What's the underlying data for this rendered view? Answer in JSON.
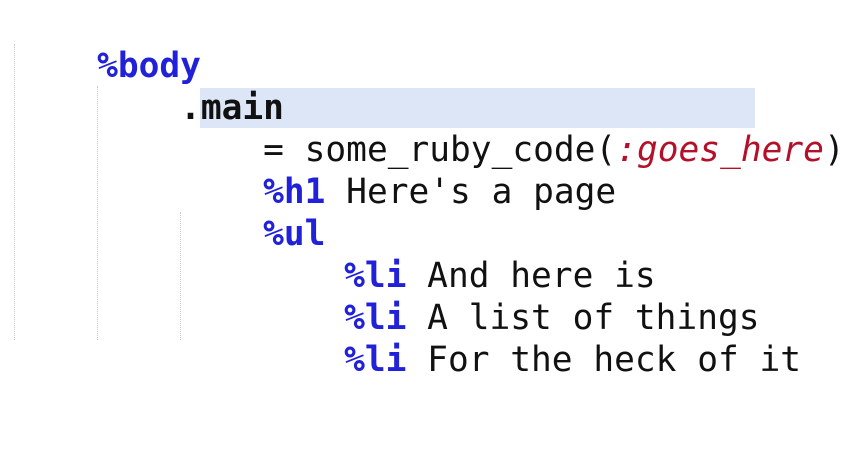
{
  "editor": {
    "lines": [
      {
        "tag": "%body"
      },
      {
        "klass": ".main"
      },
      {
        "op": "=",
        "pre": " some_ruby_code(",
        "symbol": ":goes_here",
        "post": ")"
      },
      {
        "tag": "%h1",
        "text": " Here's a page"
      },
      {
        "tag": "%ul"
      },
      {
        "tag": "%li",
        "text": " And here is"
      },
      {
        "tag": "%li",
        "text": " A list of things"
      },
      {
        "tag": "%li",
        "text": " For the heck of it"
      }
    ],
    "colors": {
      "tag": "#2121d9",
      "symbol": "#b3102a",
      "text": "#111111",
      "selection": "#dde6f7",
      "indent_guide": "#c9c9c9"
    }
  }
}
